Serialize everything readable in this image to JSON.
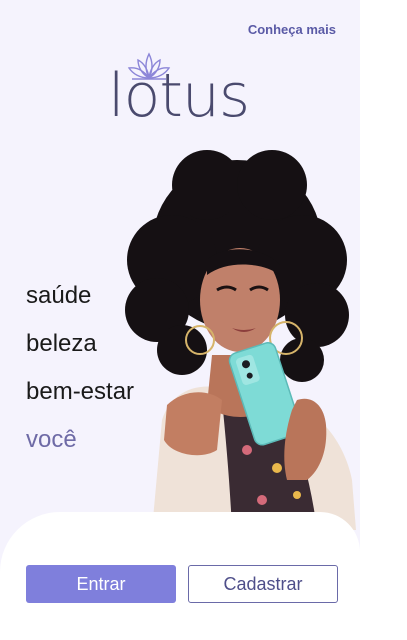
{
  "header": {
    "learn_more_link": "Conheça mais"
  },
  "logo": {
    "wordmark": "lotus",
    "icon": "lotus-flower-icon"
  },
  "hero": {
    "image": "woman-holding-phone-photo",
    "taglines": [
      "saúde",
      "beleza",
      "bem-estar",
      "você"
    ]
  },
  "actions": {
    "login_label": "Entrar",
    "signup_label": "Cadastrar"
  },
  "colors": {
    "background": "#f5f3fd",
    "accent": "#7f7fdc",
    "accent_text": "#6e6aa6",
    "outline": "#6a6aa8"
  }
}
